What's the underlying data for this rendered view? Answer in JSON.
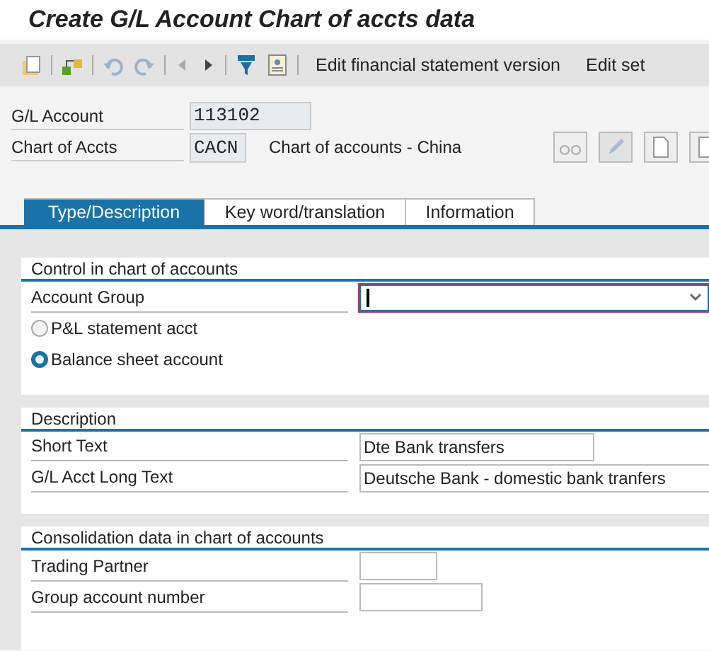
{
  "window": {
    "title": "Create G/L Account Chart of accts data"
  },
  "toolbar": {
    "buttons": [
      {
        "label": "Edit financial statement version"
      },
      {
        "label": "Edit set"
      }
    ]
  },
  "header": {
    "gl_account": {
      "label": "G/L Account",
      "value": "113102"
    },
    "chart_of_accts": {
      "label": "Chart of Accts",
      "value": "CACN",
      "description": "Chart of accounts - China"
    }
  },
  "tabs": [
    {
      "label": "Type/Description",
      "selected": true
    },
    {
      "label": "Key word/translation",
      "selected": false
    },
    {
      "label": "Information",
      "selected": false
    }
  ],
  "sections": [
    {
      "title": "Control in chart of accounts",
      "rows": [
        {
          "kind": "dropdown",
          "label": "Account Group",
          "value": "",
          "focused": true
        },
        {
          "kind": "radio",
          "label": "P&L statement acct",
          "selected": false
        },
        {
          "kind": "radio",
          "label": "Balance sheet account",
          "selected": true
        }
      ]
    },
    {
      "title": "Description",
      "rows": [
        {
          "kind": "field",
          "label": "Short Text",
          "value": "Dte Bank transfers"
        },
        {
          "kind": "field",
          "label": "G/L Acct Long Text",
          "value": "Deutsche Bank - domestic bank tranfers"
        }
      ]
    },
    {
      "title": "Consolidation data in chart of accounts",
      "rows": [
        {
          "kind": "field",
          "label": "Trading Partner",
          "value": ""
        },
        {
          "kind": "field",
          "label": "Group account number",
          "value": ""
        }
      ]
    }
  ]
}
